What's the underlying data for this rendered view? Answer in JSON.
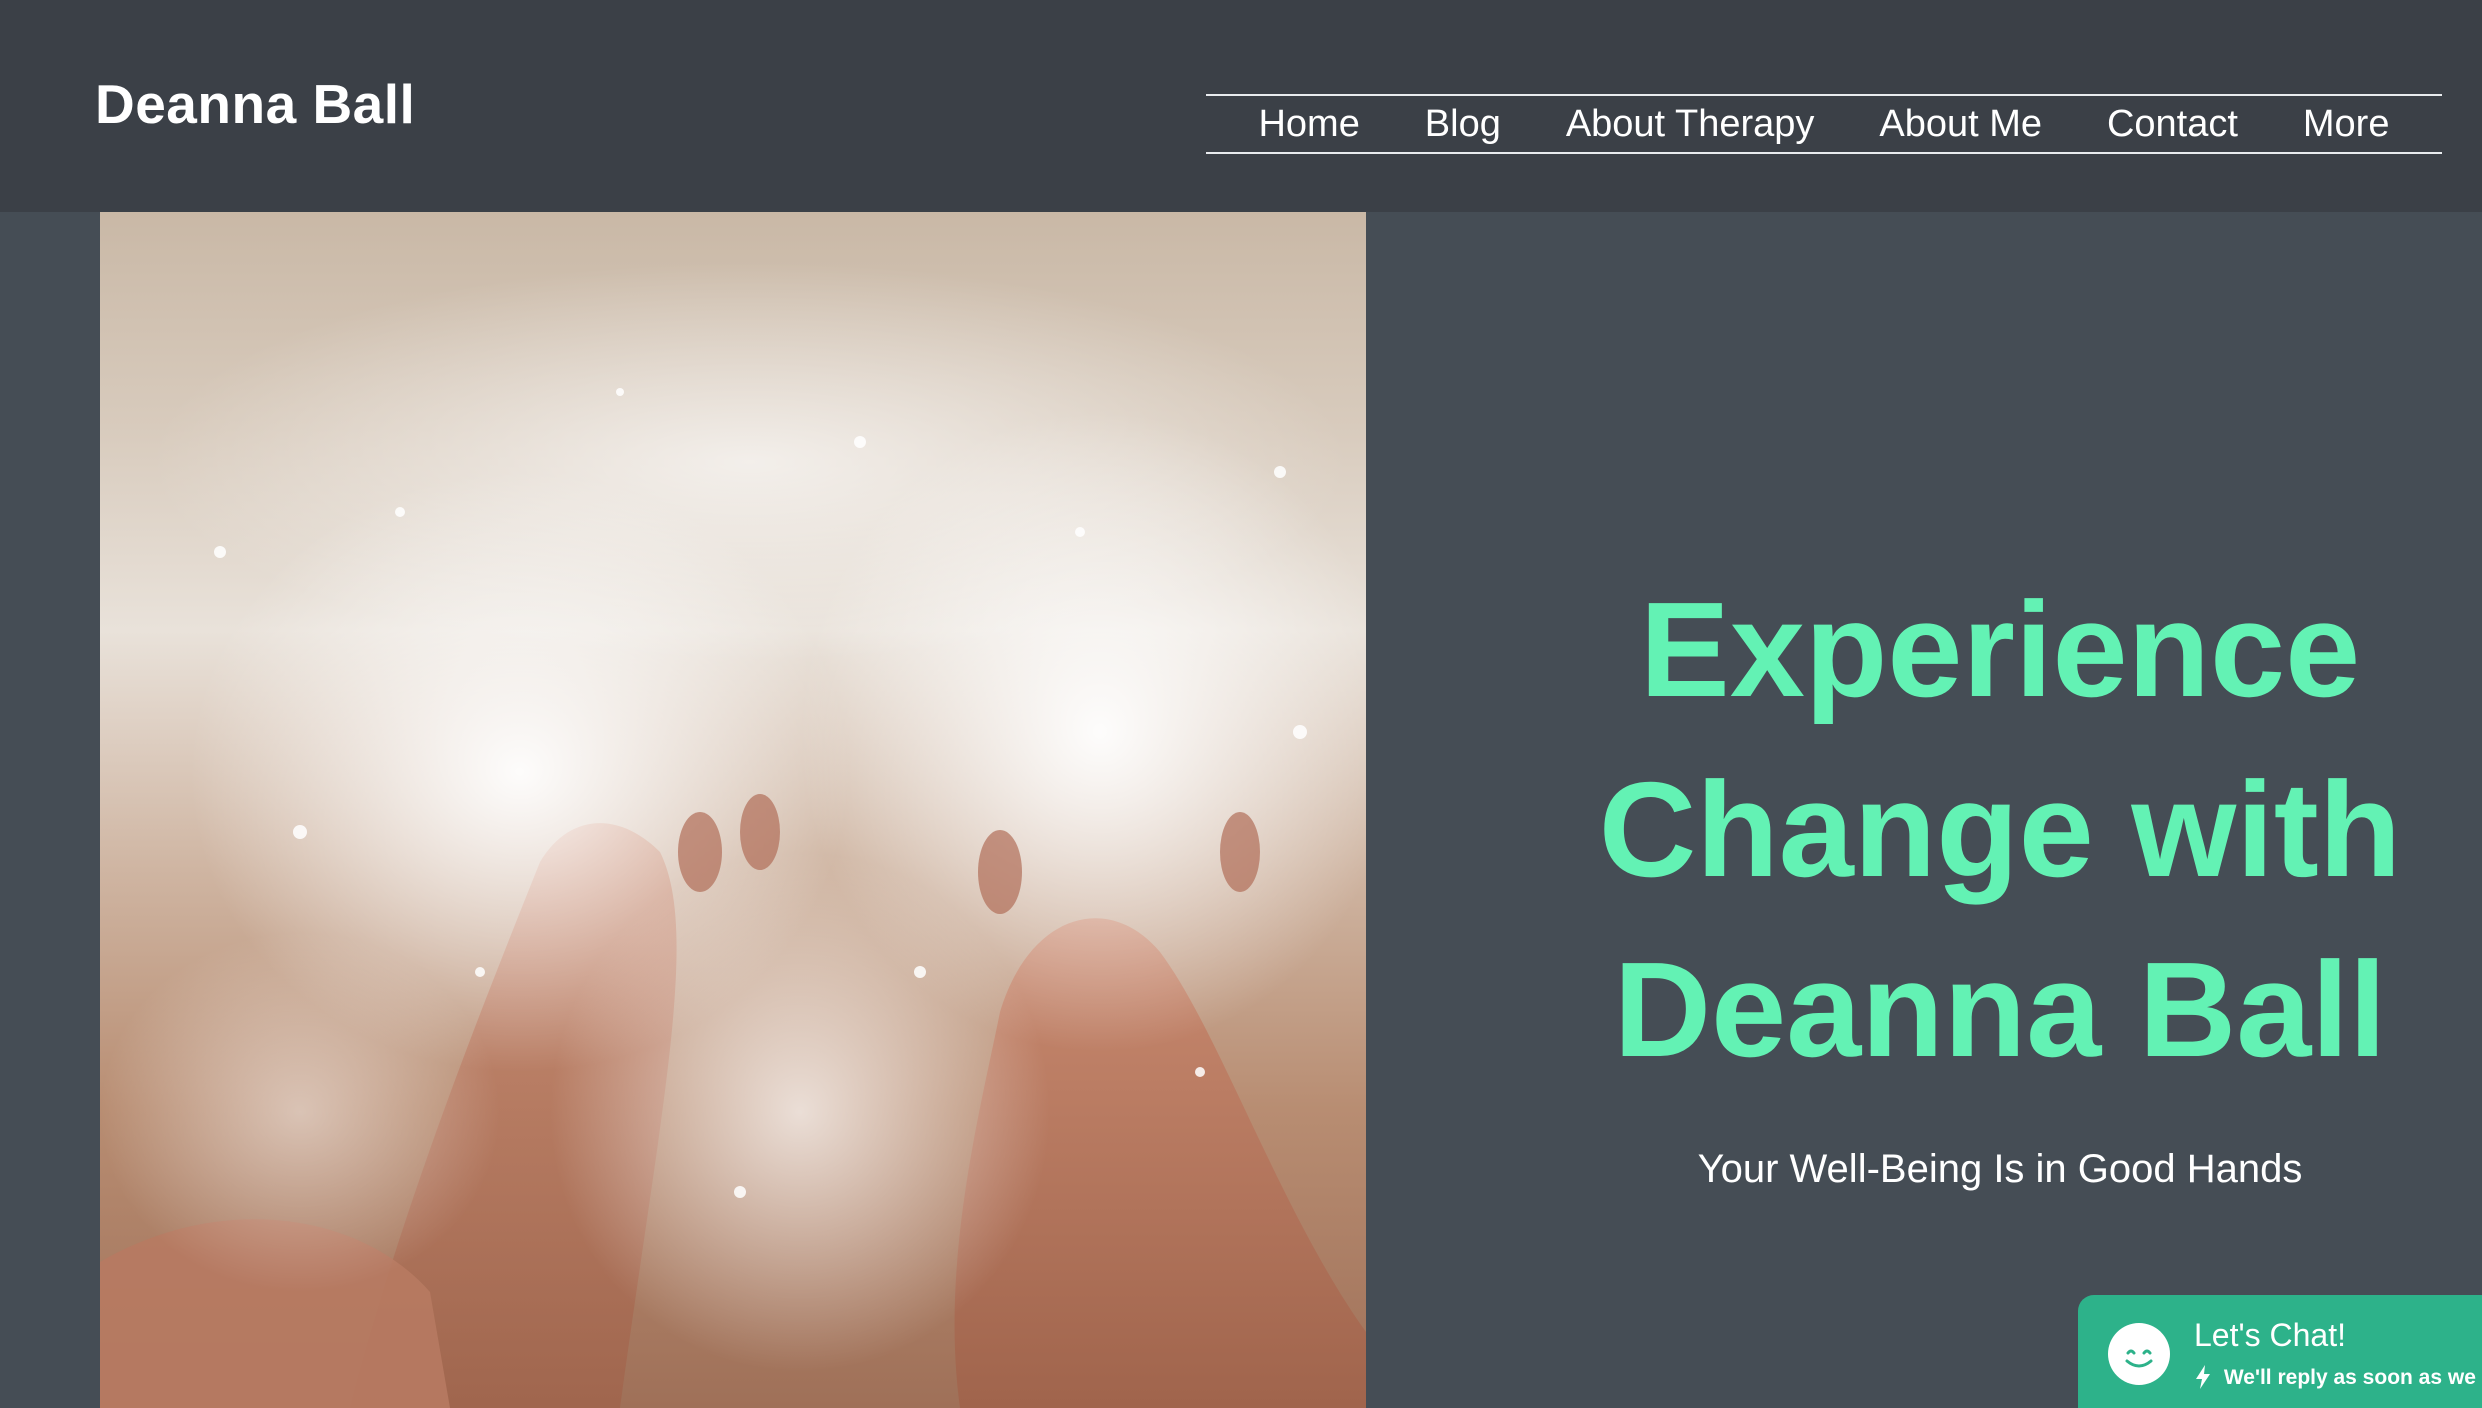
{
  "site": {
    "title": "Deanna Ball"
  },
  "nav": {
    "items": [
      "Home",
      "Blog",
      "About Therapy",
      "About Me",
      "Contact",
      "More"
    ]
  },
  "hero": {
    "heading_lines": [
      "Experience",
      "Change with",
      "Deanna Ball"
    ],
    "tagline": "Your Well-Being Is in Good Hands"
  },
  "chat": {
    "title": "Let's Chat!",
    "subtitle": "We'll reply as soon as we ca"
  },
  "colors": {
    "header_bg": "#3b4047",
    "page_bg": "#454d55",
    "accent": "#63f2b4",
    "chat_bg": "#2db28a"
  },
  "icons": {
    "chat_avatar": "smiley-icon",
    "bolt": "lightning-icon"
  }
}
